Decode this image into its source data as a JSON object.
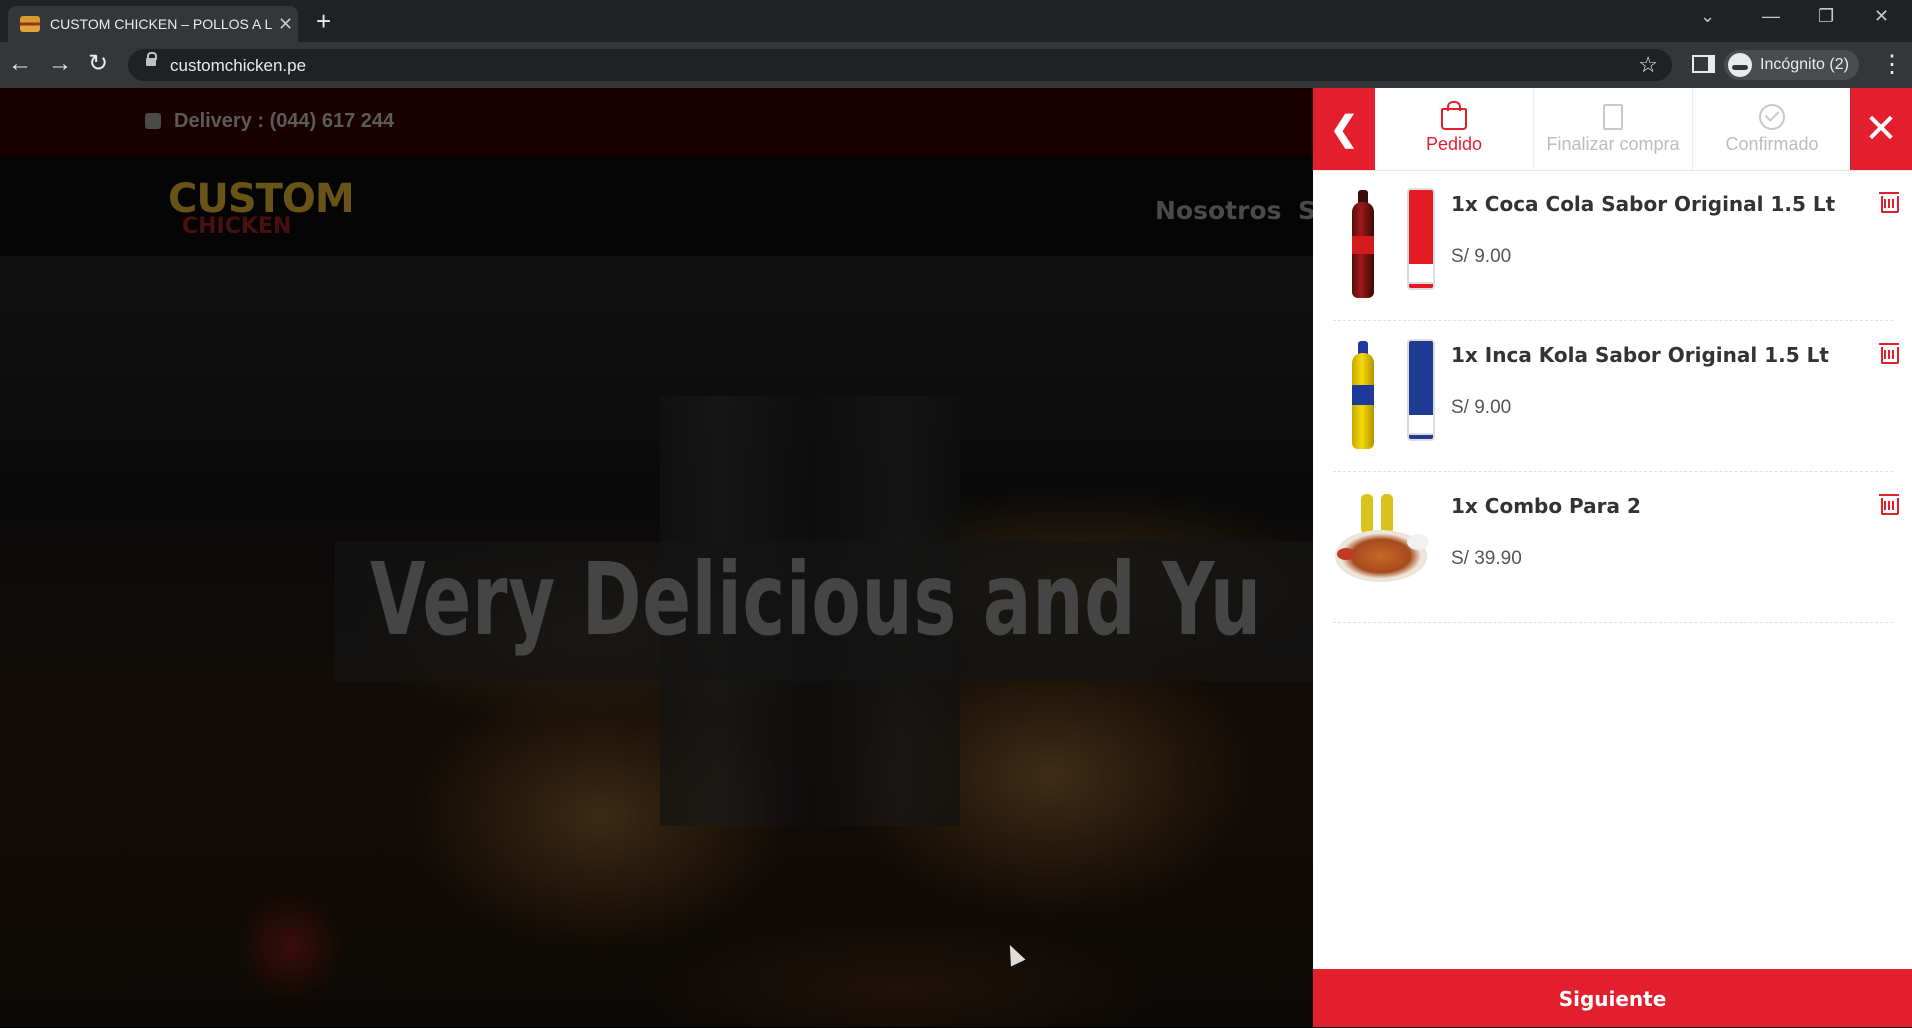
{
  "browser": {
    "tab_title": "CUSTOM CHICKEN – POLLOS A L",
    "url": "customchicken.pe",
    "profile_label": "Incógnito (2)"
  },
  "site": {
    "delivery": "Delivery : (044) 617 244",
    "logo_top": "CUSTOM",
    "logo_bottom": "CHICKEN",
    "nav": [
      "Nosotros",
      "S"
    ],
    "hero_title": "Very Delicious and Yu"
  },
  "cart": {
    "steps": [
      {
        "label": "Pedido",
        "icon": "bag-icon",
        "state": "active"
      },
      {
        "label": "Finalizar compra",
        "icon": "document-icon",
        "state": "inactive"
      },
      {
        "label": "Confirmado",
        "icon": "check-circle-icon",
        "state": "inactive"
      }
    ],
    "items": [
      {
        "name": "1x Coca Cola Sabor Original 1.5 Lt",
        "price": "S/ 9.00",
        "image": "coca-cola-bottle"
      },
      {
        "name": "1x Inca Kola Sabor Original 1.5 Lt",
        "price": "S/ 9.00",
        "image": "inca-kola-bottle"
      },
      {
        "name": "1x Combo Para 2",
        "price": "S/ 39.90",
        "image": "combo-plate"
      }
    ],
    "next_label": "Siguiente"
  },
  "colors": {
    "accent": "#e41f2d",
    "chrome_dark": "#202124",
    "chrome_mid": "#35363a"
  }
}
